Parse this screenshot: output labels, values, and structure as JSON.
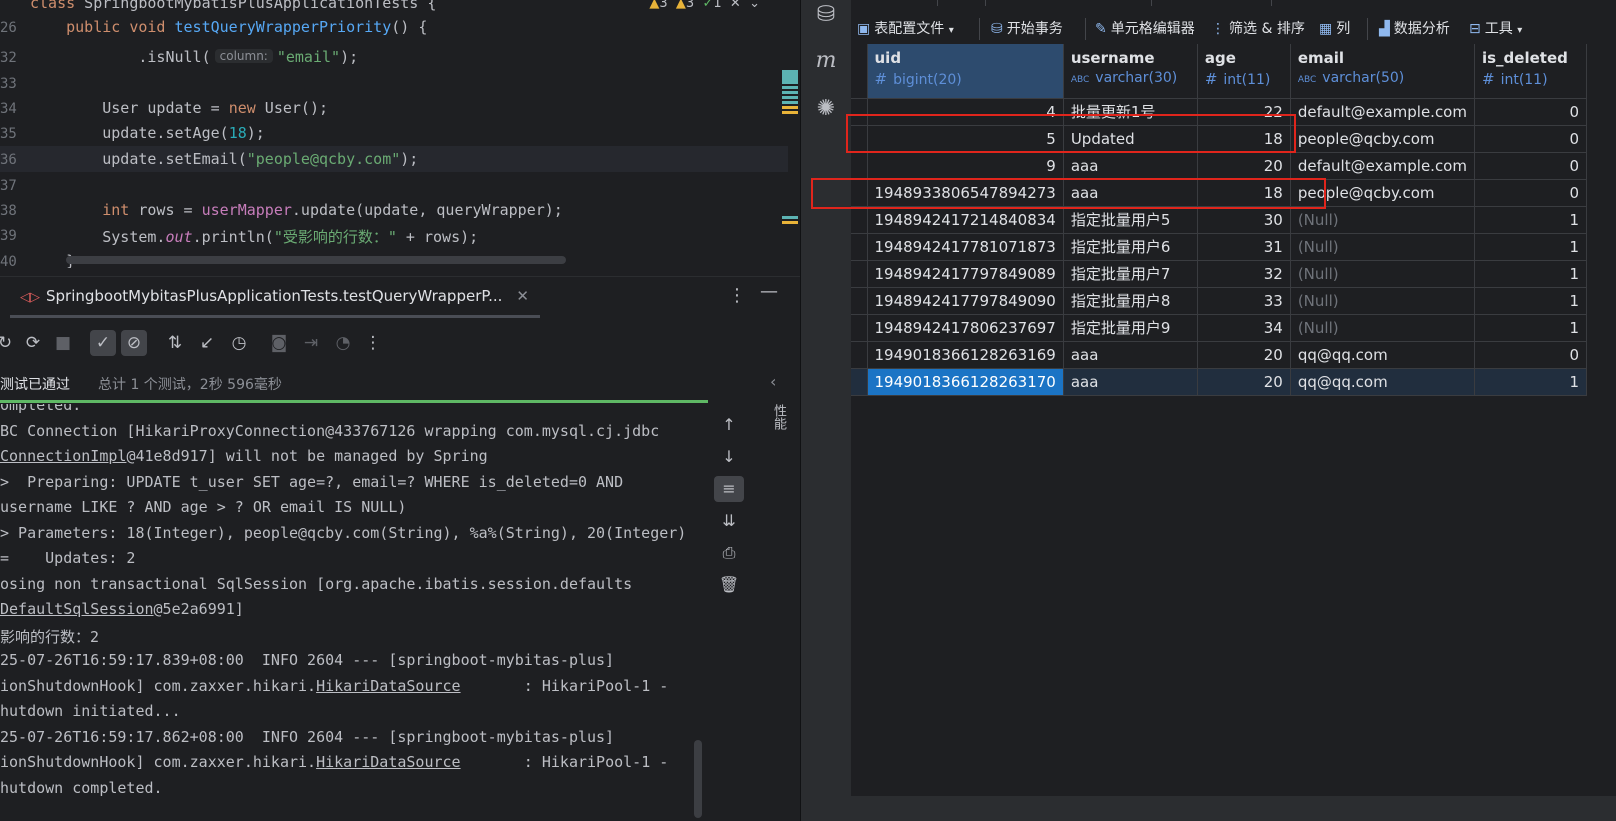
{
  "editor": {
    "lines": [
      {
        "num": "",
        "html": "<span class='kw'>class</span> SpringbootMybatisPlusApplicationTests {"
      },
      {
        "num": "26",
        "html": "    <span class='kw'>public void</span> <span class='fn'>testQueryWrapperPriority</span>() {"
      },
      {
        "num": "32",
        "html": "            .isNull(<span class='hint'>column:</span><span class='str'>\"email\"</span>);"
      },
      {
        "num": "33",
        "html": ""
      },
      {
        "num": "34",
        "html": "        User update = <span class='kw'>new</span> User();"
      },
      {
        "num": "35",
        "html": "        update.setAge(<span class='num'>18</span>);"
      },
      {
        "num": "36",
        "html": "        update.setEmail(<span class='str'>\"people@qcby.com\"</span>);"
      },
      {
        "num": "37",
        "html": ""
      },
      {
        "num": "38",
        "html": "        <span class='kw'>int</span> rows = <span class='fld'>userMapper</span>.update(update, queryWrapper);"
      },
      {
        "num": "39",
        "html": "        System.<span class='fld it'>out</span>.println(<span class='str'>\"受影响的行数：\"</span> + rows);"
      },
      {
        "num": "40",
        "html": "    }"
      }
    ],
    "inspections": {
      "warn1": "3",
      "warn2": "3",
      "ok": "1"
    }
  },
  "run": {
    "tab_title": "SpringbootMybitasPlusApplicationTests.testQueryWrapperP...",
    "status": "测试已通过",
    "status_detail": "总计 1 个测试，2秒 596毫秒",
    "side_tab": "性能",
    "console": [
      {
        "text": "ompleted."
      },
      {
        "text": "BC Connection [HikariProxyConnection@433767126 wrapping com.mysql.cj.jdbc"
      },
      {
        "html": "<span class='link'>ConnectionImpl</span>@41e8d917] will not be managed by Spring"
      },
      {
        "text": ">  Preparing: UPDATE t_user SET age=?, email=? WHERE is_deleted=0 AND"
      },
      {
        "text": "username LIKE ? AND age > ? OR email IS NULL)"
      },
      {
        "text": "> Parameters: 18(Integer), people@qcby.com(String), %a%(String), 20(Integer)"
      },
      {
        "text": "=    Updates: 2"
      },
      {
        "text": "osing non transactional SqlSession [org.apache.ibatis.session.defaults"
      },
      {
        "html": "<span class='link'>DefaultSqlSession</span>@5e2a6991]"
      },
      {
        "text": "影响的行数：2"
      },
      {
        "text": "25-07-26T16:59:17.839+08:00  INFO 2604 --- [springboot-mybitas-plus]"
      },
      {
        "html": "ionShutdownHook] com.zaxxer.hikari.<span class='link'>HikariDataSource</span>       : HikariPool-1 -"
      },
      {
        "text": "hutdown initiated..."
      },
      {
        "text": "25-07-26T16:59:17.862+08:00  INFO 2604 --- [springboot-mybitas-plus]"
      },
      {
        "html": "ionShutdownHook] com.zaxxer.hikari.<span class='link'>HikariDataSource</span>       : HikariPool-1 -"
      },
      {
        "text": "hutdown completed."
      }
    ]
  },
  "grid_toolbar": {
    "table_config": "表配置文件",
    "begin_tx": "开始事务",
    "cell_editor": "单元格编辑器",
    "filter_sort": "筛选 & 排序",
    "columns": "列",
    "analysis": "数据分析",
    "tools": "工具"
  },
  "grid": {
    "columns": [
      {
        "name": "uid",
        "type": "bigint(20)",
        "icon": "#"
      },
      {
        "name": "username",
        "type": "varchar(30)",
        "icon": "ABC"
      },
      {
        "name": "age",
        "type": "int(11)",
        "icon": "#"
      },
      {
        "name": "email",
        "type": "varchar(50)",
        "icon": "ABC"
      },
      {
        "name": "is_deleted",
        "type": "int(11)",
        "icon": "#"
      }
    ],
    "rows": [
      {
        "uid": "4",
        "username": "批量更新1号",
        "age": "22",
        "email": "default@example.com",
        "is_deleted": "0"
      },
      {
        "uid": "5",
        "username": "Updated",
        "age": "18",
        "email": "people@qcby.com",
        "is_deleted": "0"
      },
      {
        "uid": "9",
        "username": "aaa",
        "age": "20",
        "email": "default@example.com",
        "is_deleted": "0"
      },
      {
        "uid": "1948933806547894273",
        "username": "aaa",
        "age": "18",
        "email": "people@qcby.com",
        "is_deleted": "0"
      },
      {
        "uid": "1948942417214840834",
        "username": "指定批量用户5",
        "age": "30",
        "email": "(Null)",
        "is_deleted": "1"
      },
      {
        "uid": "1948942417781071873",
        "username": "指定批量用户6",
        "age": "31",
        "email": "(Null)",
        "is_deleted": "1"
      },
      {
        "uid": "1948942417797849089",
        "username": "指定批量用户7",
        "age": "32",
        "email": "(Null)",
        "is_deleted": "1"
      },
      {
        "uid": "1948942417797849090",
        "username": "指定批量用户8",
        "age": "33",
        "email": "(Null)",
        "is_deleted": "1"
      },
      {
        "uid": "1948942417806237697",
        "username": "指定批量用户9",
        "age": "34",
        "email": "(Null)",
        "is_deleted": "1"
      },
      {
        "uid": "1949018366128263169",
        "username": "aaa",
        "age": "20",
        "email": "qq@qq.com",
        "is_deleted": "0"
      },
      {
        "uid": "1949018366128263170",
        "username": "aaa",
        "age": "20",
        "email": "qq@qq.com",
        "is_deleted": "1"
      }
    ],
    "selected_row": 10,
    "highlighted_rows": [
      1,
      3
    ]
  },
  "colors": {
    "accent": "#1b74c5",
    "highlight_box": "#e0251c",
    "pass": "#5fb865"
  }
}
